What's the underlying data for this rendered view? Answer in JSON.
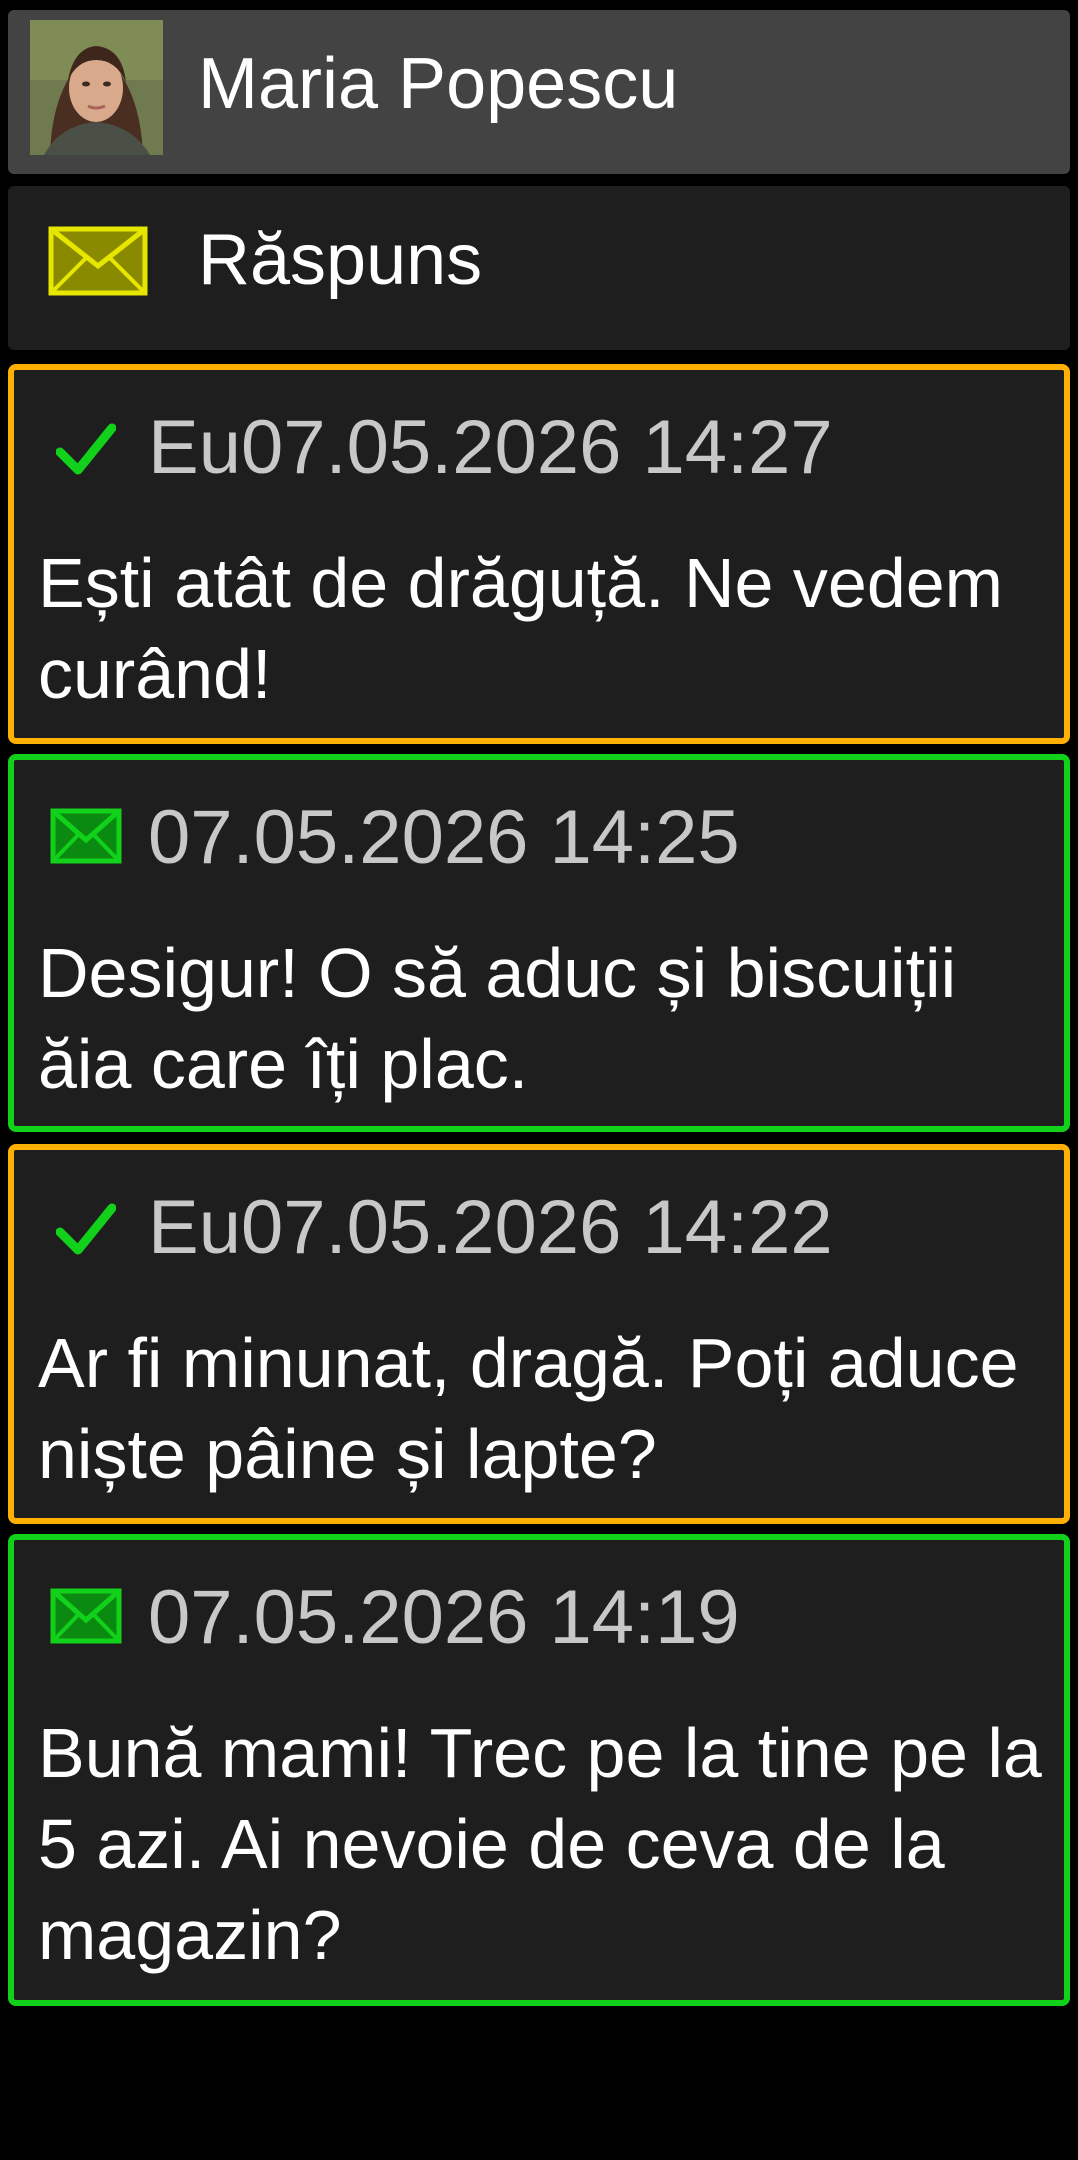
{
  "contact": {
    "name": "Maria Popescu",
    "avatar_icon": "contact-photo"
  },
  "reply": {
    "label": "Răspuns",
    "icon": "envelope-icon",
    "icon_color": "#e6e600"
  },
  "colors": {
    "sent_border": "#ffb000",
    "received_border": "#11d11a",
    "check": "#11d11a",
    "received_icon": "#11d11a"
  },
  "messages": [
    {
      "direction": "sent",
      "status_icon": "checkmark-icon",
      "sender": "Eu",
      "timestamp": "07.05.2026 14:27",
      "text": "Ești atât de drăguță. Ne vedem curând!"
    },
    {
      "direction": "received",
      "status_icon": "envelope-icon",
      "sender": "",
      "timestamp": "07.05.2026 14:25",
      "text": "Desigur! O să aduc și biscuiții ăia care îți plac."
    },
    {
      "direction": "sent",
      "status_icon": "checkmark-icon",
      "sender": "Eu",
      "timestamp": "07.05.2026 14:22",
      "text": "Ar fi minunat, dragă. Poți aduce niște pâine și lapte?"
    },
    {
      "direction": "received",
      "status_icon": "envelope-icon",
      "sender": "",
      "timestamp": "07.05.2026 14:19",
      "text": "Bună mami! Trec pe la tine pe la 5 azi. Ai nevoie de ceva de la magazin?"
    }
  ]
}
